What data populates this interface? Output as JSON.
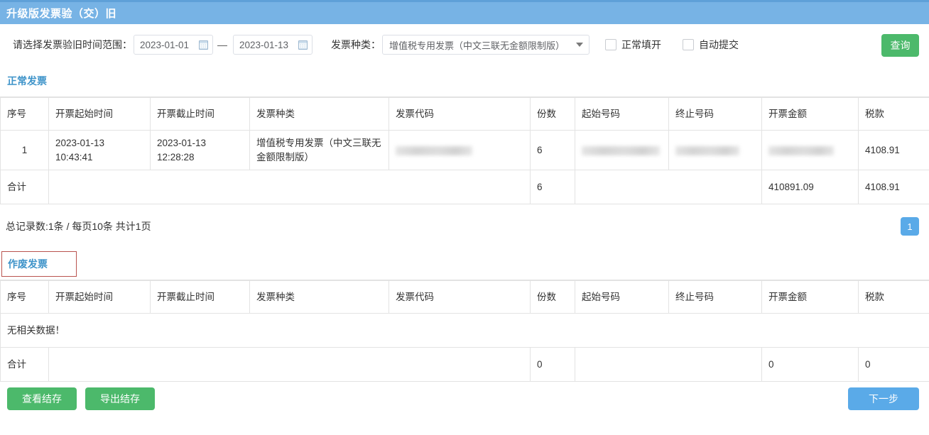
{
  "window": {
    "title": "升级版发票验（交）旧"
  },
  "filter": {
    "date_range_label": "请选择发票验旧时间范围：",
    "date_start": "2023-01-01",
    "date_end": "2023-01-13",
    "range_separator": "—",
    "calendar_icon": "calendar-icon",
    "invoice_type_label": "发票种类：",
    "invoice_type_value": "增值税专用发票（中文三联无金额限制版）",
    "checkbox_normal_fill": "正常填开",
    "checkbox_auto_submit": "自动提交",
    "query_button": "查询",
    "query_button_color": "#4cb96b"
  },
  "normal_section": {
    "tab_label": "正常发票",
    "tab_color": "#3d93c9",
    "columns": [
      "序号",
      "开票起始时间",
      "开票截止时间",
      "发票种类",
      "发票代码",
      "份数",
      "起始号码",
      "终止号码",
      "开票金额",
      "税款"
    ],
    "rows": [
      {
        "序号": "1",
        "开票起始时间": "2023-01-13 10:43:41",
        "开票截止时间": "2023-01-13 12:28:28",
        "发票种类": "增值税专用发票（中文三联无金额限制版）",
        "发票代码": "",
        "份数": "6",
        "起始号码": "",
        "终止号码": "",
        "开票金额": "",
        "税款": "4108.91"
      }
    ],
    "summary": {
      "label": "合计",
      "份数": "6",
      "开票金额": "410891.09",
      "税款": "4108.91"
    },
    "pager": {
      "summary_text": "总记录数:1条 / 每页10条 共计1页",
      "current_page": "1"
    }
  },
  "void_section": {
    "tab_label": "作废发票",
    "tab_color": "#3d93c9",
    "tab_focus_border_color": "#b9534f",
    "columns": [
      "序号",
      "开票起始时间",
      "开票截止时间",
      "发票种类",
      "发票代码",
      "份数",
      "起始号码",
      "终止号码",
      "开票金额",
      "税款"
    ],
    "empty_text": "无相关数据！",
    "summary": {
      "label": "合计",
      "份数": "0",
      "开票金额": "0",
      "税款": "0"
    }
  },
  "footer": {
    "view_balance_button": "查看结存",
    "export_balance_button": "导出结存",
    "next_step_button": "下一步",
    "green": "#4cb96b",
    "blue": "#5aaae8"
  }
}
